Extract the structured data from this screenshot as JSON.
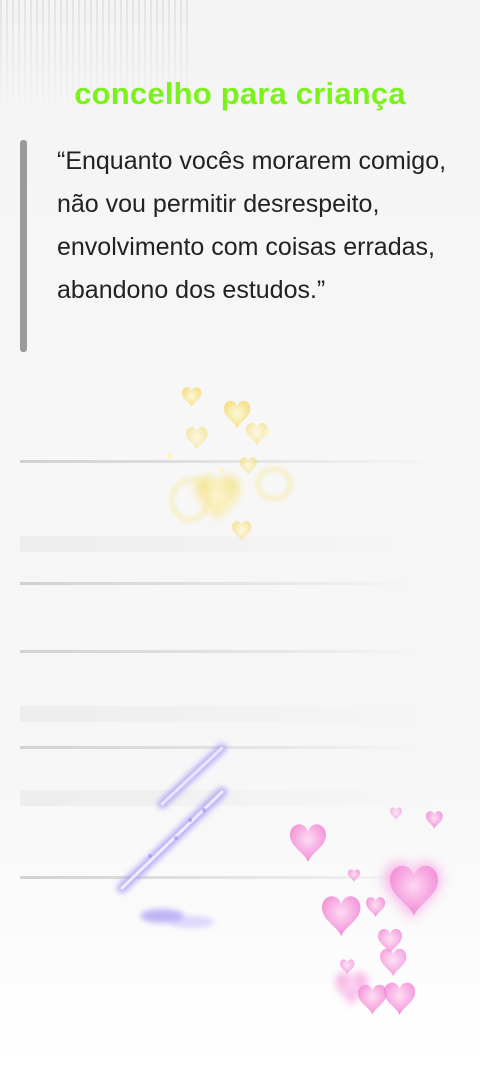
{
  "title": "concelho para criança",
  "quote": "“Enquanto vocês morarem comigo, não vou permitir desrespeito, envolvimento com coisas erradas, abandono dos estudos.”",
  "colors": {
    "title": "#7cf21c",
    "quote_bar": "#9a9a9a",
    "text": "#222222",
    "hearts_yellow": "#f3dc72",
    "hearts_pink": "#f07fd2",
    "sparkle_purple": "#8f7cf0"
  },
  "decorations": [
    "yellow-hearts-sticker",
    "purple-sparkle-sticker",
    "pink-hearts-sticker"
  ]
}
